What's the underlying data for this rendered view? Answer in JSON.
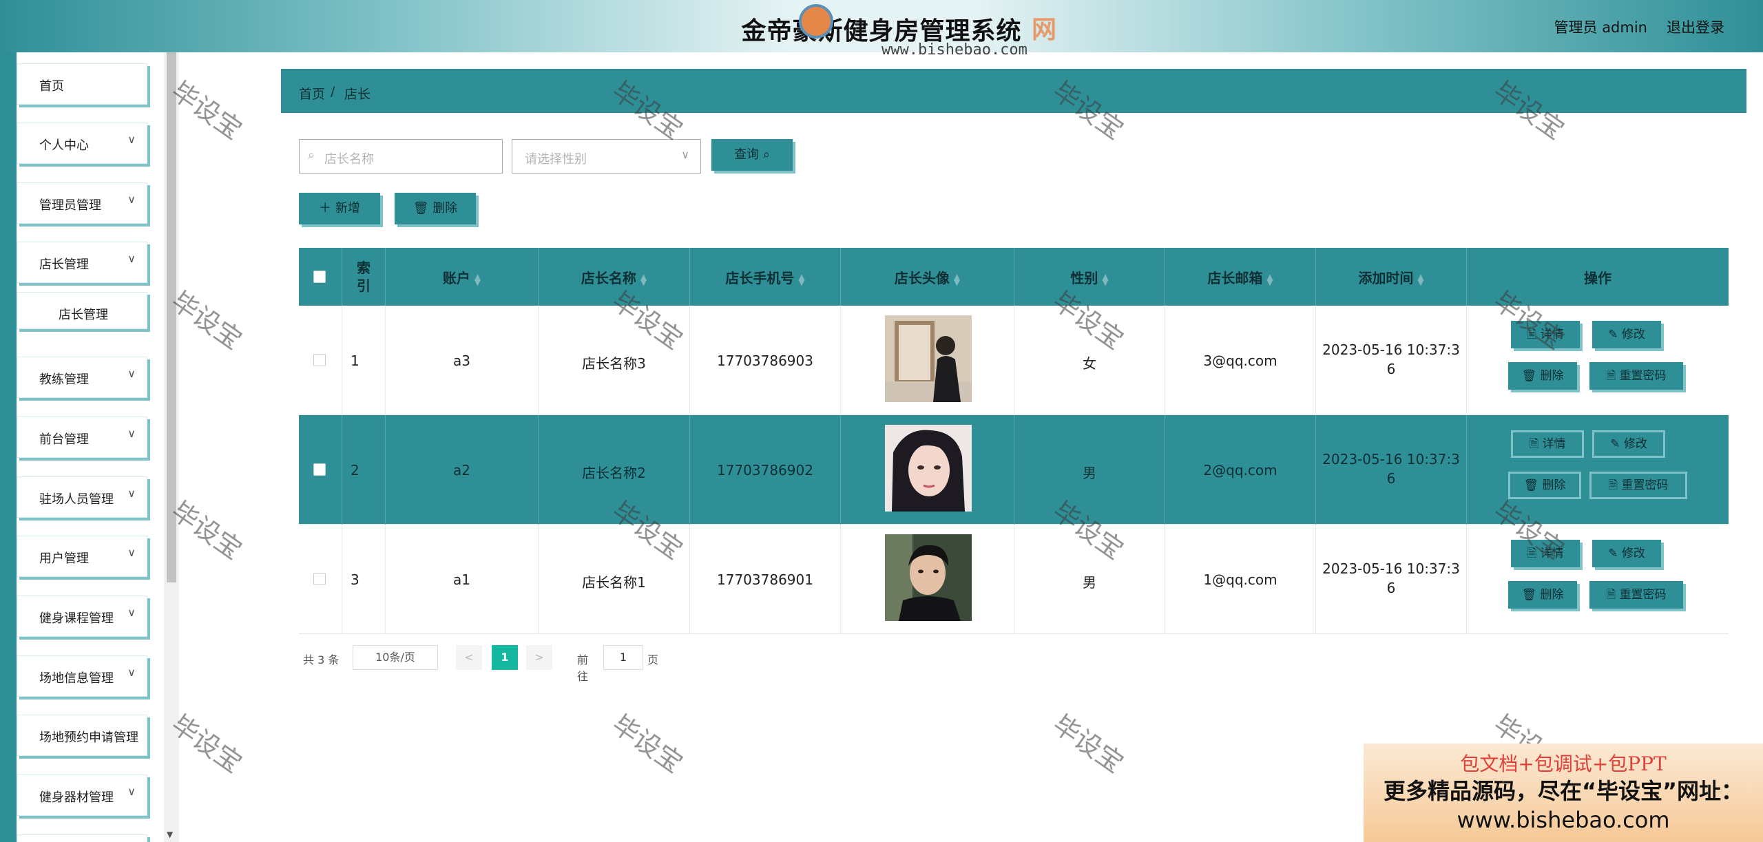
{
  "header": {
    "title": "金帝豪斯健身房管理系统",
    "admin": "管理员 admin",
    "logout": "退出登录"
  },
  "logo": {
    "url": "www.bishebao.com",
    "glyph": "网"
  },
  "sidebar": {
    "items": [
      {
        "label": "首页"
      },
      {
        "label": "个人中心",
        "chevron": "∨"
      },
      {
        "label": "管理员管理",
        "chevron": "∨"
      },
      {
        "label": "店长管理",
        "chevron": "∨"
      },
      {
        "label": "店长管理"
      },
      {
        "label": "教练管理",
        "chevron": "∨"
      },
      {
        "label": "前台管理",
        "chevron": "∨"
      },
      {
        "label": "驻场人员管理",
        "chevron": "∨"
      },
      {
        "label": "用户管理",
        "chevron": "∨"
      },
      {
        "label": "健身课程管理",
        "chevron": "∨"
      },
      {
        "label": "场地信息管理",
        "chevron": "∨"
      },
      {
        "label": "场地预约申请管理"
      },
      {
        "label": "健身器材管理",
        "chevron": "∨"
      }
    ]
  },
  "breadcrumb": {
    "home": "首页",
    "sep": "/",
    "current": "店长"
  },
  "search": {
    "name_placeholder": "店长名称",
    "gender_placeholder": "请选择性别",
    "query_label": "查询 ⌕"
  },
  "actions": {
    "add_label": "＋ 新增",
    "delete_label": "🗑 删除"
  },
  "table": {
    "headers": [
      "索引",
      "账户",
      "店长名称",
      "店长手机号",
      "店长头像",
      "性别",
      "店长邮箱",
      "添加时间",
      "操作"
    ],
    "rows": [
      {
        "index": "1",
        "account": "a3",
        "name": "店长名称3",
        "phone": "17703786903",
        "gender": "女",
        "email": "3@qq.com",
        "time": "2023-05-16 10:37:3",
        "time2": "6"
      },
      {
        "index": "2",
        "account": "a2",
        "name": "店长名称2",
        "phone": "17703786902",
        "gender": "男",
        "email": "2@qq.com",
        "time": "2023-05-16 10:37:3",
        "time2": "6"
      },
      {
        "index": "3",
        "account": "a1",
        "name": "店长名称1",
        "phone": "17703786901",
        "gender": "男",
        "email": "1@qq.com",
        "time": "2023-05-16 10:37:3",
        "time2": "6"
      }
    ],
    "ops": {
      "detail": "详情",
      "edit": "修改",
      "delete": "删除",
      "reset": "重置密码"
    }
  },
  "pager": {
    "total": "共 3 条",
    "size": "10条/页",
    "prev": "<",
    "current": "1",
    "next": ">",
    "goto": "前往",
    "goto_value": "1",
    "page": "页"
  },
  "watermark": "毕设宝",
  "ad": {
    "line1": "包文档+包调试+包PPT",
    "line2": "更多精品源码，尽在“毕设宝”网址：",
    "line3": "www.bishebao.com"
  }
}
